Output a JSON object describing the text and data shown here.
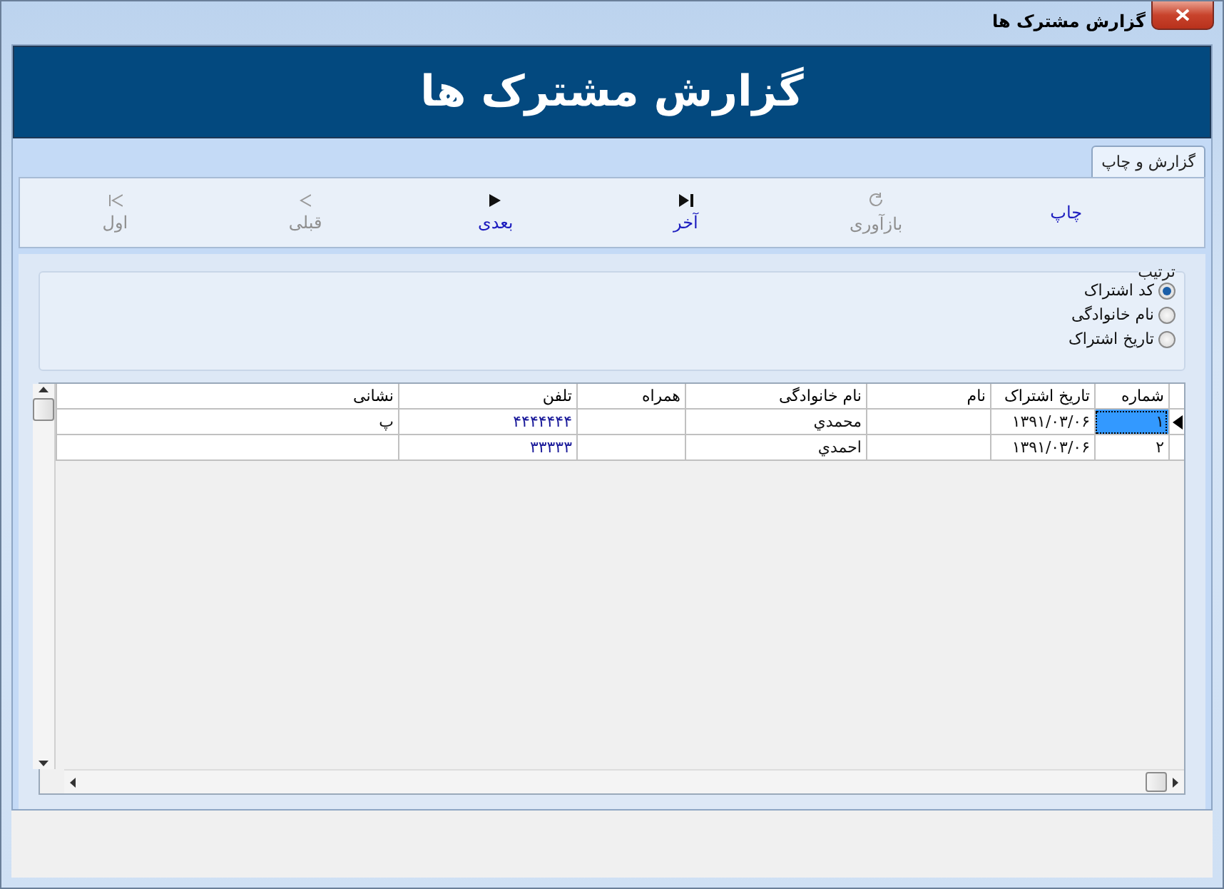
{
  "window": {
    "title": "گزارش مشترک ها"
  },
  "header": {
    "title": "گزارش مشترک ها"
  },
  "tabs": [
    {
      "label": "گزارش و چاپ",
      "selected": true
    }
  ],
  "toolbar": [
    {
      "kind": "print",
      "label": "چاپ",
      "disabled": false
    },
    {
      "kind": "refresh",
      "label": "بازآوری",
      "disabled": true
    },
    {
      "kind": "last",
      "label": "آخر",
      "disabled": false
    },
    {
      "kind": "next",
      "label": "بعدی",
      "disabled": false
    },
    {
      "kind": "previous",
      "label": "قبلی",
      "disabled": true
    },
    {
      "kind": "first",
      "label": "اول",
      "disabled": true
    }
  ],
  "sort": {
    "title": "ترتیب",
    "options": [
      {
        "label": "کد اشتراک",
        "selected": true
      },
      {
        "label": "نام خانوادگی",
        "selected": false
      },
      {
        "label": "تاریخ اشتراک",
        "selected": false
      }
    ]
  },
  "table": {
    "columns": [
      "شماره",
      "تاریخ اشتراک",
      "نام",
      "نام خانوادگی",
      "همراه",
      "تلفن",
      "نشانی"
    ],
    "rows": [
      {
        "selected": true,
        "cells": [
          "۱",
          "۱۳۹۱/۰۳/۰۶",
          "",
          "محمدي",
          "",
          "۴۴۴۴۴۴۴",
          "پ"
        ]
      },
      {
        "selected": false,
        "cells": [
          "۲",
          "۱۳۹۱/۰۳/۰۶",
          "",
          "احمدي",
          "",
          "۳۳۳۳۳",
          ""
        ]
      }
    ]
  }
}
